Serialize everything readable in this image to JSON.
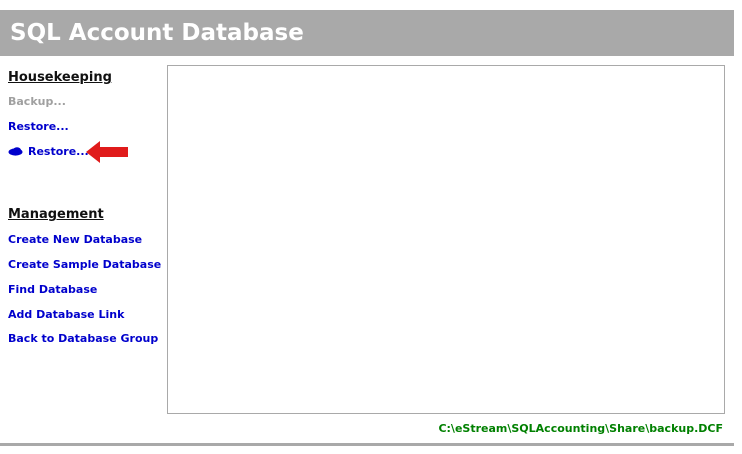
{
  "app": {
    "title": "SQL Account Database"
  },
  "housekeeping": {
    "heading": "Housekeeping",
    "items": [
      {
        "label": "Backup...",
        "enabled": false
      },
      {
        "label": "Restore...",
        "enabled": true
      },
      {
        "label": "Restore...",
        "enabled": true,
        "icon": "cloud-icon"
      }
    ]
  },
  "management": {
    "heading": "Management",
    "items": [
      {
        "label": "Create New Database"
      },
      {
        "label": "Create Sample Database"
      },
      {
        "label": "Find Database"
      },
      {
        "label": "Add Database Link"
      },
      {
        "label": "Back to Database Group"
      }
    ]
  },
  "status": {
    "path": "C:\\eStream\\SQLAccounting\\Share\\backup.DCF"
  },
  "annotation": {
    "icon": "red-left-arrow-icon"
  },
  "colors": {
    "header_bg": "#a9a9a9",
    "link": "#0000cc",
    "disabled": "#a0a0a0",
    "path_text": "#008000",
    "annotation_arrow": "#e01b1b"
  }
}
